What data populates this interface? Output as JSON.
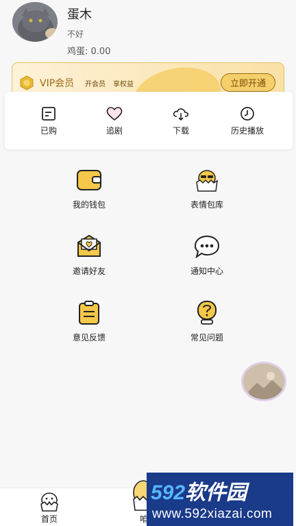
{
  "profile": {
    "username": "蛋木",
    "bio": "不好",
    "eggs_label": "鸡蛋:",
    "eggs_value": "0.00"
  },
  "vip": {
    "title": "VIP会员",
    "sub1": "开会员",
    "sub2": "享权益",
    "cta": "立即开通",
    "accent": "#f4cf6a"
  },
  "quick": [
    {
      "label": "已购",
      "icon": "purchased-icon"
    },
    {
      "label": "追剧",
      "icon": "heart-icon"
    },
    {
      "label": "下载",
      "icon": "cloud-download-icon"
    },
    {
      "label": "历史播放",
      "icon": "history-clock-icon"
    }
  ],
  "menu": [
    {
      "label": "我的钱包",
      "icon": "wallet-icon"
    },
    {
      "label": "表情包库",
      "icon": "sticker-chick-icon"
    },
    {
      "label": "邀请好友",
      "icon": "invite-envelope-icon"
    },
    {
      "label": "通知中心",
      "icon": "chat-bubble-icon"
    },
    {
      "label": "意见反馈",
      "icon": "clipboard-icon"
    },
    {
      "label": "常见问题",
      "icon": "question-bubble-icon"
    }
  ],
  "tabs": [
    {
      "label": "首页",
      "icon": "chick-home-icon"
    },
    {
      "label": "咱听",
      "icon": "chick-egg-icon"
    }
  ],
  "watermark": {
    "brand_num": "592",
    "brand_text": "软件园",
    "url": "www.592xiazai.com"
  }
}
